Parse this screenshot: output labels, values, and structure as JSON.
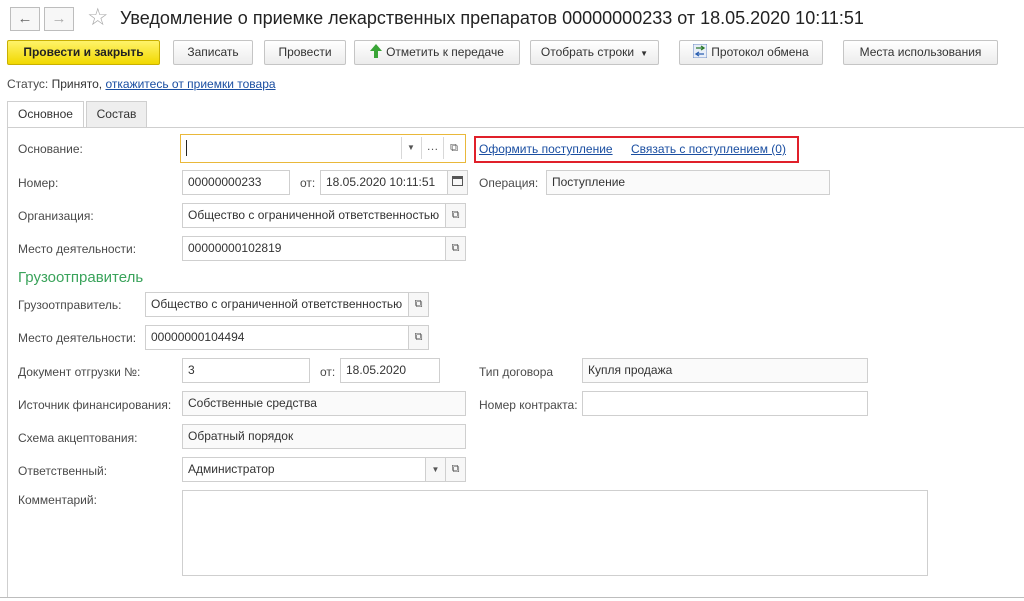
{
  "window": {
    "title": "Уведомление о приемке лекарственных препаратов 00000000233 от 18.05.2020 10:11:51",
    "back_icon": "←",
    "forward_icon": "→",
    "favorite_icon": "☆"
  },
  "toolbar": {
    "post_close": "Провести и закрыть",
    "save": "Записать",
    "post": "Провести",
    "mark_transfer": "Отметить к передаче",
    "select_rows": "Отобрать строки",
    "exchange_log": "Протокол обмена",
    "usage_places": "Места использования"
  },
  "status": {
    "label": "Статус:",
    "value": "Принято,",
    "link": "откажитесь от приемки товара"
  },
  "tabs": {
    "main": "Основное",
    "composition": "Состав"
  },
  "form": {
    "basis_label": "Основание:",
    "basis_value": "",
    "create_receipt_link": "Оформить поступление",
    "link_receipt_link": "Связать с поступлением (0)",
    "number_label": "Номер:",
    "number_value": "00000000233",
    "from_label": "от:",
    "date_value": "18.05.2020 10:11:51",
    "operation_label": "Операция:",
    "operation_value": "Поступление",
    "organization_label": "Организация:",
    "organization_value": "Общество с ограниченной ответственностью",
    "activity_place_label": "Место деятельности:",
    "activity_place_value": "00000000102819",
    "consignor_section": "Грузоотправитель",
    "consignor_label": "Грузоотправитель:",
    "consignor_value": "Общество с ограниченной ответственностью",
    "consignor_place_label": "Место деятельности:",
    "consignor_place_value": "00000000104494",
    "shipment_doc_label": "Документ отгрузки №:",
    "shipment_doc_value": "3",
    "shipment_from_label": "от:",
    "shipment_date_value": "18.05.2020",
    "contract_type_label": "Тип договора",
    "contract_type_value": "Купля продажа",
    "funding_label": "Источник финансирования:",
    "funding_value": "Собственные средства",
    "contract_number_label": "Номер контракта:",
    "contract_number_value": "",
    "acceptance_label": "Схема акцептования:",
    "acceptance_value": "Обратный порядок",
    "responsible_label": "Ответственный:",
    "responsible_value": "Администратор",
    "comment_label": "Комментарий:",
    "comment_value": ""
  }
}
